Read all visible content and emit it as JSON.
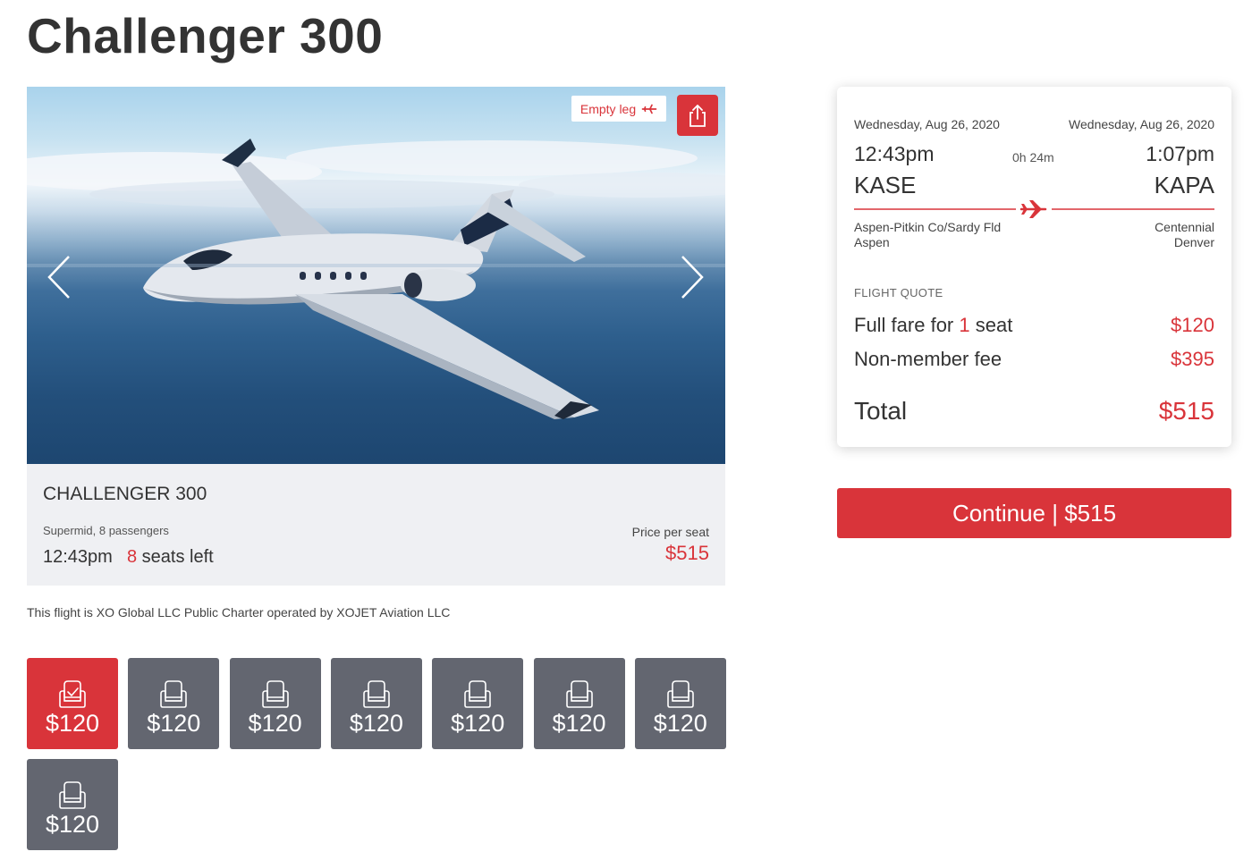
{
  "page": {
    "title": "Challenger 300"
  },
  "hero": {
    "badge_label": "Empty leg",
    "badge_icon": "plane-icon",
    "share_icon": "share-icon",
    "prev_icon": "chevron-left-icon",
    "next_icon": "chevron-right-icon"
  },
  "aircraft": {
    "name": "CHALLENGER 300",
    "class": "Supermid, 8 passengers",
    "departure_time": "12:43pm",
    "seats_left_count": "8",
    "seats_left_text": " seats left",
    "price_label": "Price per seat",
    "price": "$515"
  },
  "operator_note": "This flight is XO Global LLC Public Charter operated by XOJET Aviation LLC",
  "seats": [
    {
      "price": "$120",
      "selected": true
    },
    {
      "price": "$120",
      "selected": false
    },
    {
      "price": "$120",
      "selected": false
    },
    {
      "price": "$120",
      "selected": false
    },
    {
      "price": "$120",
      "selected": false
    },
    {
      "price": "$120",
      "selected": false
    },
    {
      "price": "$120",
      "selected": false
    },
    {
      "price": "$120",
      "selected": false
    }
  ],
  "summary": {
    "departure": {
      "date": "Wednesday, Aug 26, 2020",
      "time": "12:43pm",
      "code": "KASE",
      "airport": "Aspen-Pitkin Co/Sardy Fld",
      "city": "Aspen"
    },
    "arrival": {
      "date": "Wednesday, Aug 26, 2020",
      "time": "1:07pm",
      "code": "KAPA",
      "airport": "Centennial",
      "city": "Denver"
    },
    "duration": "0h 24m",
    "quote_label": "FLIGHT QUOTE",
    "fare_label_prefix": "Full fare for ",
    "fare_seat_count": "1",
    "fare_label_suffix": " seat",
    "fare_value": "$120",
    "fee_label": "Non-member fee",
    "fee_value": "$395",
    "total_label": "Total",
    "total_value": "$515"
  },
  "continue_label": "Continue | $515",
  "colors": {
    "accent": "#d9343a",
    "seat_default": "#636670",
    "card_bg": "#eff0f3"
  }
}
